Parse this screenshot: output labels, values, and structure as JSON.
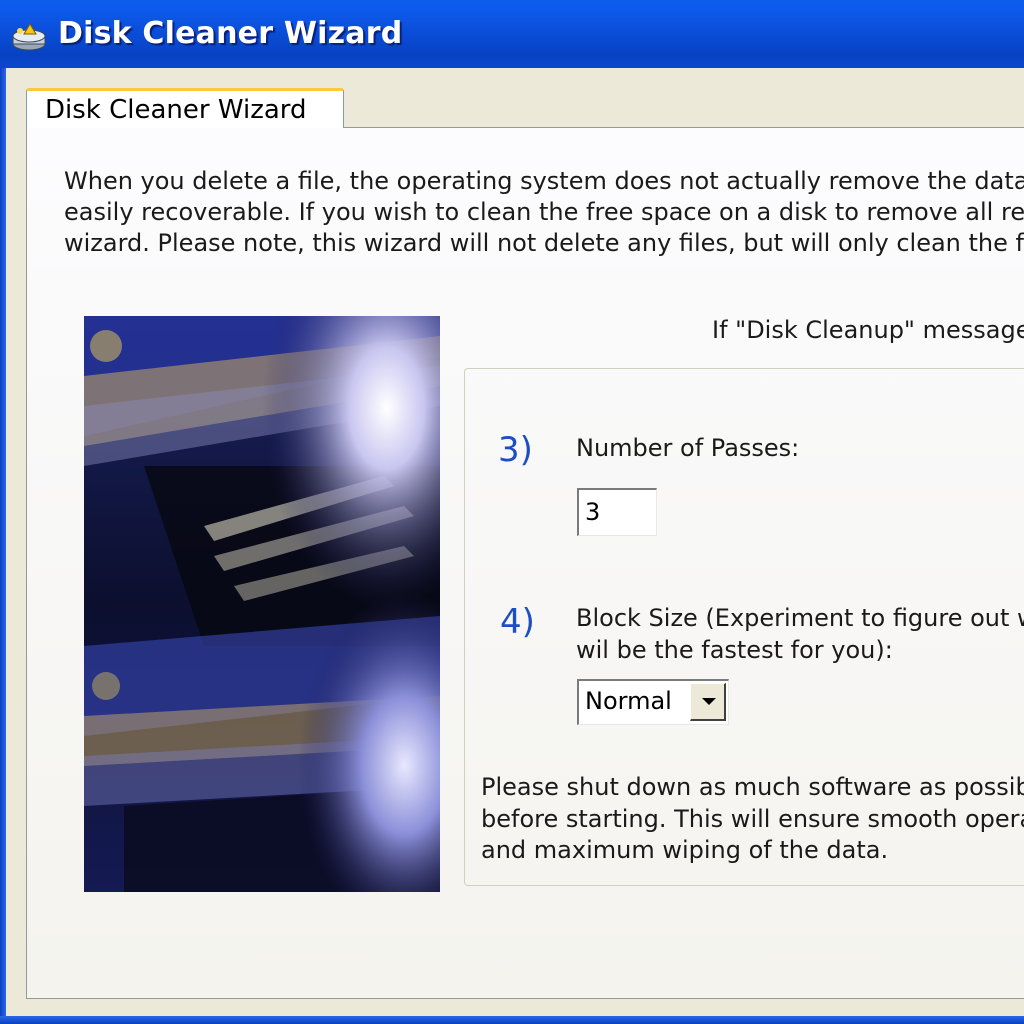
{
  "window": {
    "title": "Disk Cleaner Wizard",
    "icon": "disk-cleaner-app-icon"
  },
  "tab": {
    "label": "Disk Cleaner Wizard"
  },
  "intro": {
    "lines": [
      "When you delete a file, the operating system does not actually remove the data from",
      "easily recoverable. If you wish to clean the free space on a disk to remove all remain",
      "wizard. Please note, this wizard will not delete any files, but will only clean the free s"
    ]
  },
  "cleanup_message": "If \"Disk Cleanup\" message a",
  "steps": {
    "passes": {
      "number": "3)",
      "label": "Number of Passes:",
      "value": "3"
    },
    "block_size": {
      "number": "4)",
      "label_lines": [
        "Block Size (Experiment to figure out whi",
        "wil be the fastest for you):"
      ],
      "selected": "Normal",
      "arrow_icon": "dropdown-arrow-icon"
    }
  },
  "note": {
    "lines": [
      "Please shut down as much software as possible",
      "before starting. This will ensure smooth operatio",
      "and maximum wiping of the data."
    ]
  },
  "colors": {
    "titlebar": "#0b4fd9",
    "step_number": "#1c4fc4",
    "tab_highlight": "#ffc83c",
    "dialog_bg": "#ece9d8"
  }
}
